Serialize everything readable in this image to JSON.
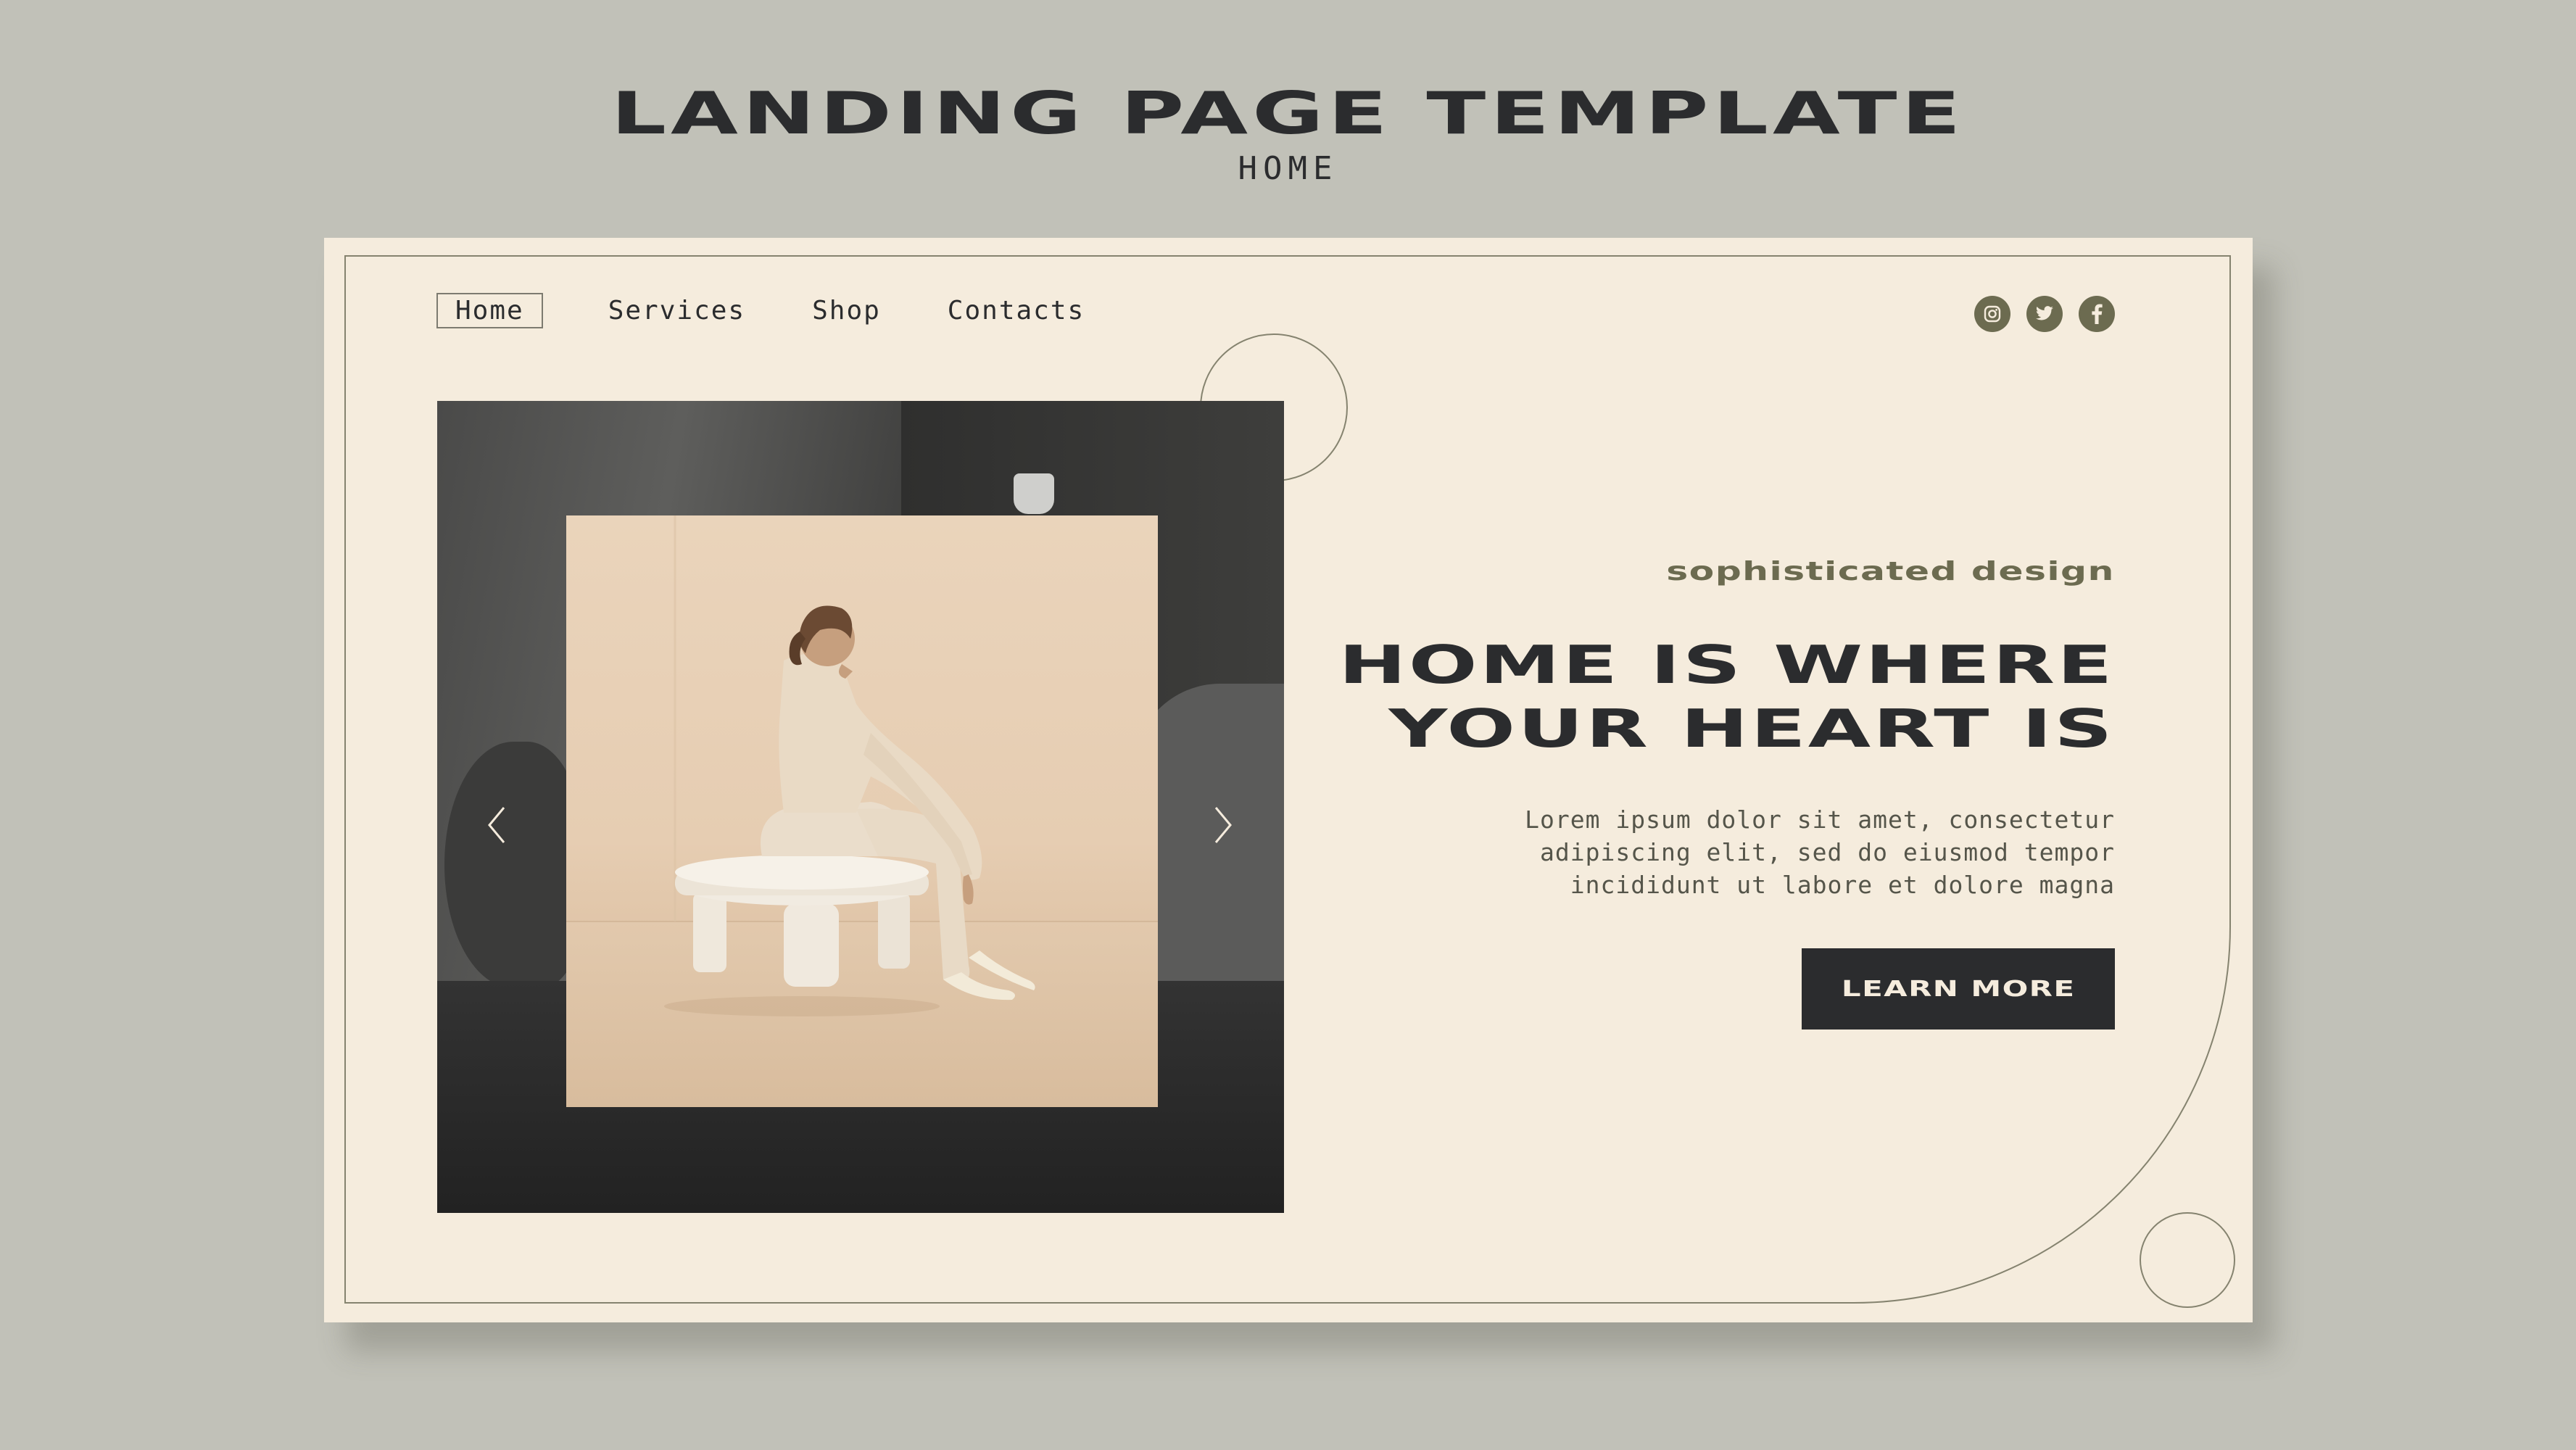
{
  "page": {
    "heading": "LANDING PAGE TEMPLATE",
    "subheading": "HOME"
  },
  "nav": {
    "items": [
      {
        "label": "Home",
        "active": true
      },
      {
        "label": "Services",
        "active": false
      },
      {
        "label": "Shop",
        "active": false
      },
      {
        "label": "Contacts",
        "active": false
      }
    ]
  },
  "social": {
    "icons": [
      "instagram-icon",
      "twitter-icon",
      "facebook-icon"
    ],
    "color": "#6c6b50"
  },
  "carousel": {
    "prev_icon": "chevron-left-icon",
    "next_icon": "chevron-right-icon"
  },
  "hero": {
    "tagline": "sophisticated design",
    "headline_line1": "HOME IS WHERE",
    "headline_line2": "YOUR HEART IS",
    "body": "Lorem ipsum dolor sit amet, consectetur\nadipiscing elit, sed do eiusmod tempor\nincididunt ut labore et dolore magna",
    "cta_label": "LEARN MORE"
  },
  "colors": {
    "background": "#c1c1b8",
    "card": "#f5ecdd",
    "dark": "#2b2c2e",
    "accent": "#6c6b50"
  }
}
